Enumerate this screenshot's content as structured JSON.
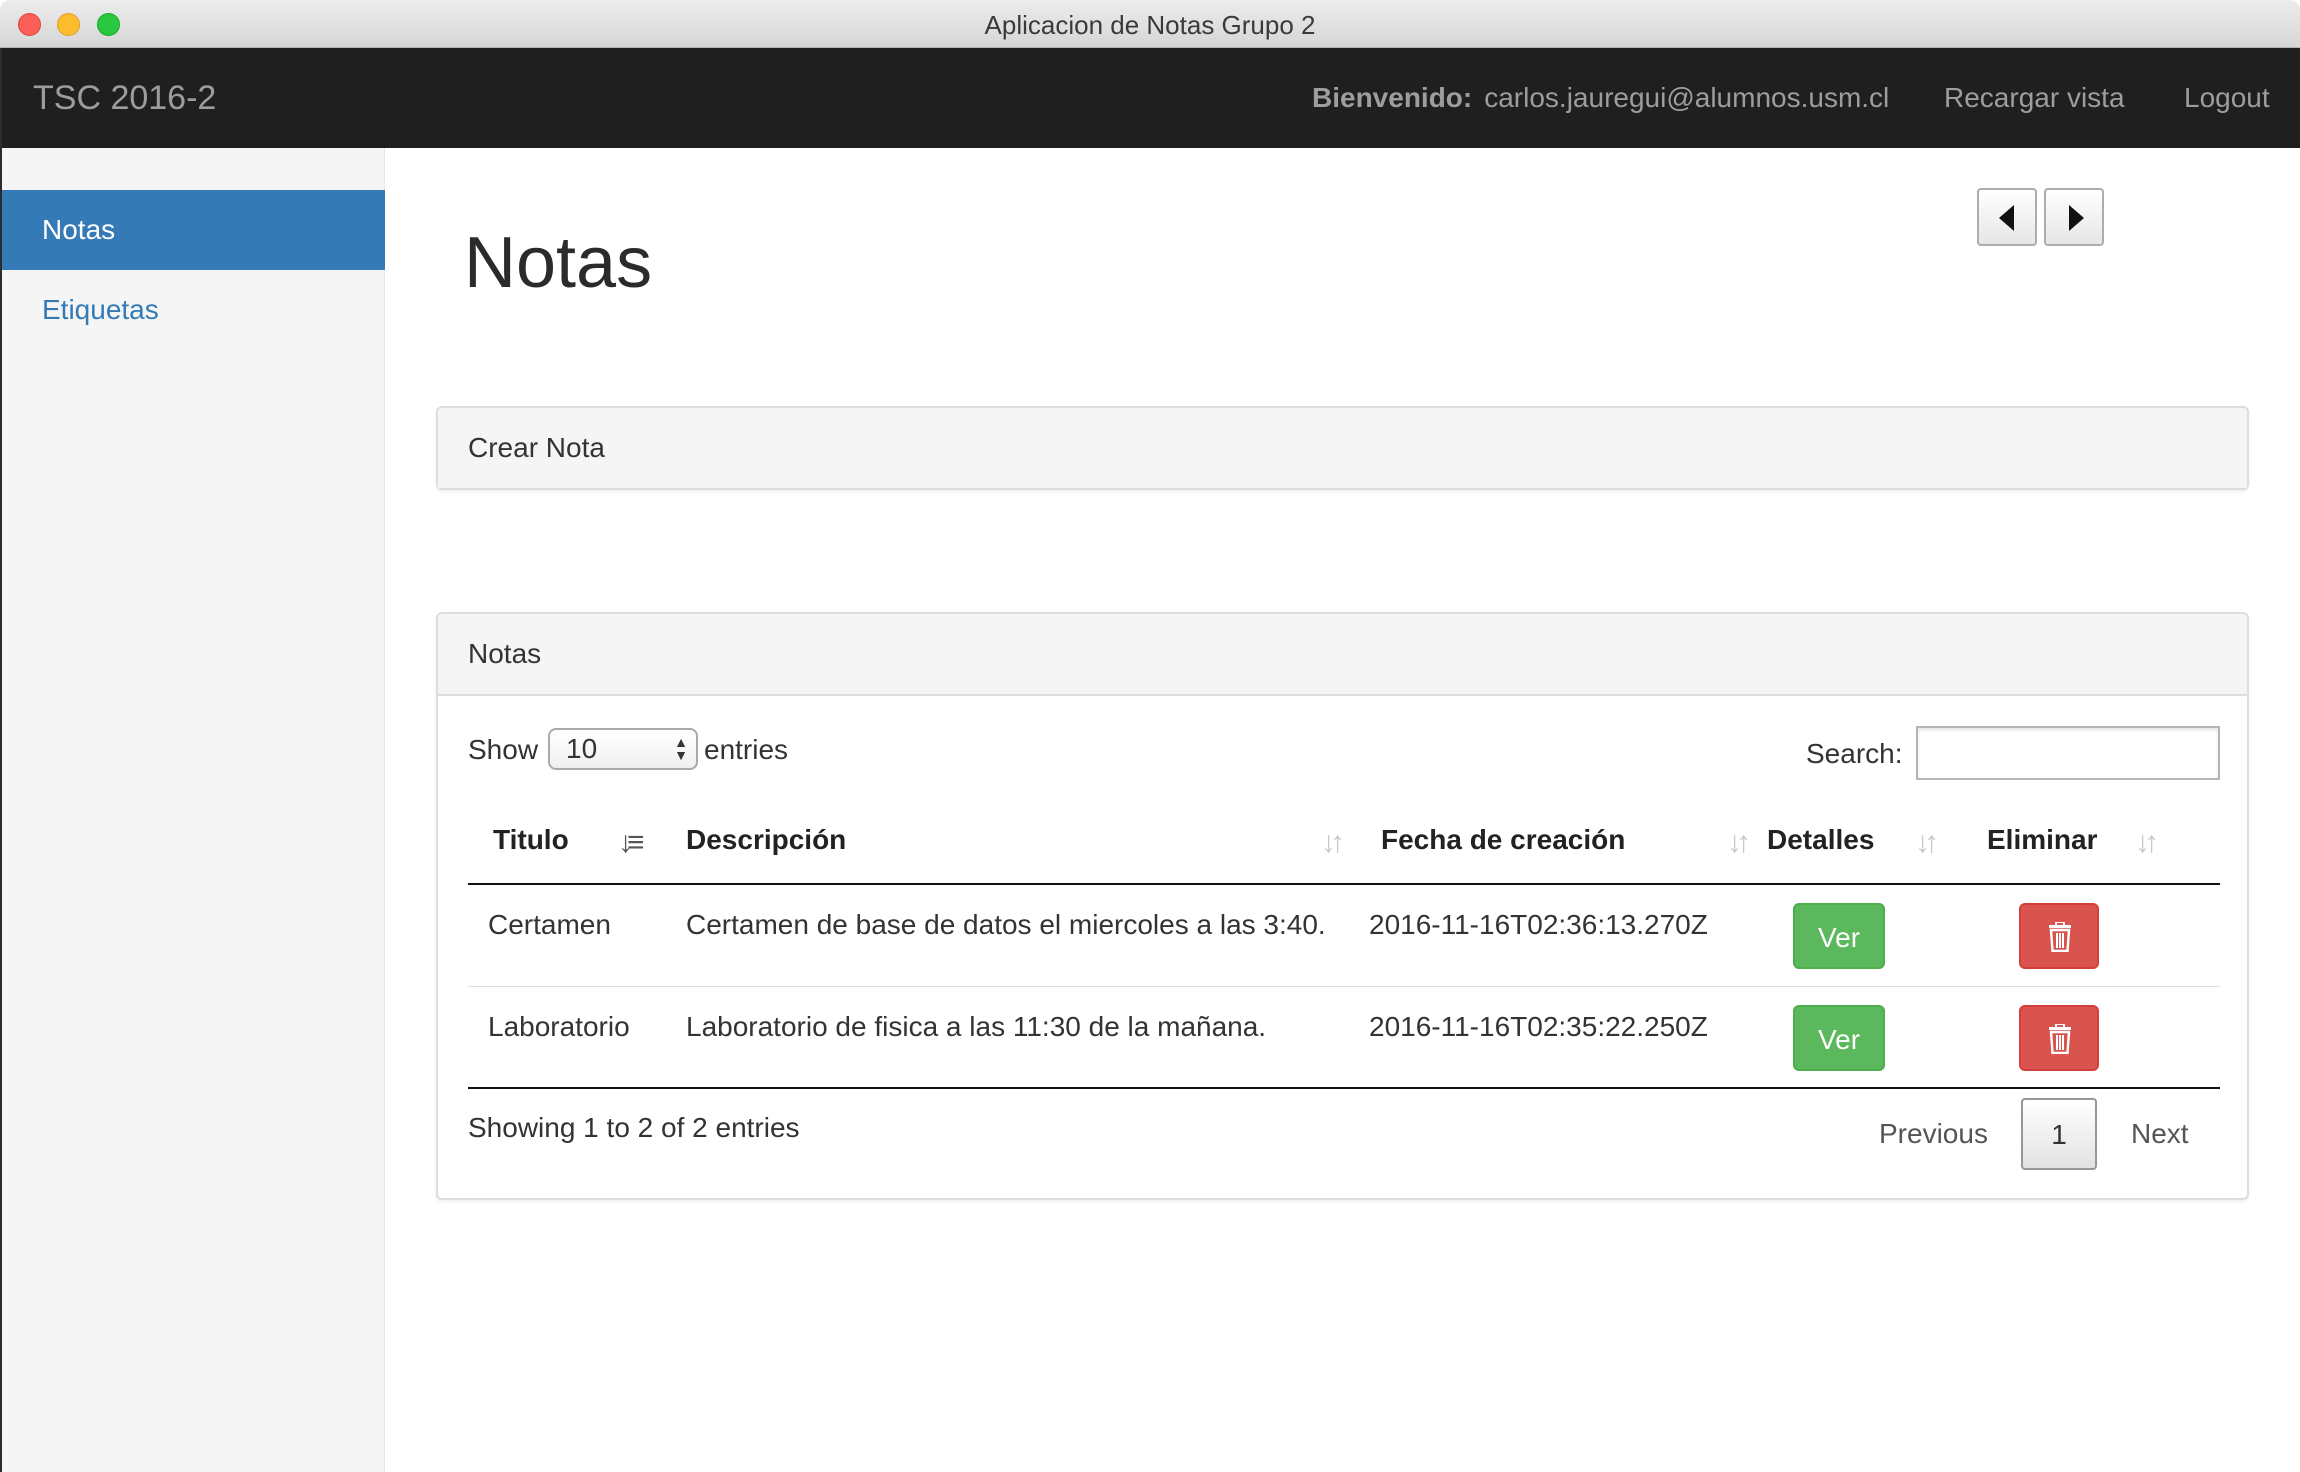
{
  "window": {
    "title": "Aplicacion de Notas Grupo 2"
  },
  "navbar": {
    "brand": "TSC 2016-2",
    "welcome_label": "Bienvenido:",
    "user_email": "carlos.jauregui@alumnos.usm.cl",
    "reload_label": "Recargar vista",
    "logout_label": "Logout"
  },
  "sidebar": {
    "items": [
      {
        "label": "Notas",
        "active": true
      },
      {
        "label": "Etiquetas",
        "active": false
      }
    ]
  },
  "main": {
    "title": "Notas",
    "create_panel_title": "Crear Nota",
    "list_panel_title": "Notas"
  },
  "table_controls": {
    "show_label": "Show",
    "entries_value": "10",
    "entries_label": "entries",
    "search_label": "Search:",
    "search_value": ""
  },
  "table": {
    "columns": [
      "Titulo",
      "Descripción",
      "Fecha de creación",
      "Detalles",
      "Eliminar"
    ],
    "sorted_column": "Titulo",
    "rows": [
      {
        "titulo": "Certamen",
        "descripcion": "Certamen de base de datos el miercoles a las 3:40.",
        "fecha": "2016-11-16T02:36:13.270Z",
        "ver_label": "Ver"
      },
      {
        "titulo": "Laboratorio",
        "descripcion": "Laboratorio de fisica a las 11:30 de la mañana.",
        "fecha": "2016-11-16T02:35:22.250Z",
        "ver_label": "Ver"
      }
    ]
  },
  "pagination": {
    "info": "Showing 1 to 2 of 2 entries",
    "previous_label": "Previous",
    "current_page": "1",
    "next_label": "Next"
  },
  "colors": {
    "navbar_bg": "#1f1f1f",
    "active_nav": "#337ab7",
    "success": "#5cb85c",
    "danger": "#d9534f"
  },
  "icons": [
    "caret-left-icon",
    "caret-right-icon",
    "sort-icon",
    "trash-icon",
    "select-arrows-icon"
  ]
}
